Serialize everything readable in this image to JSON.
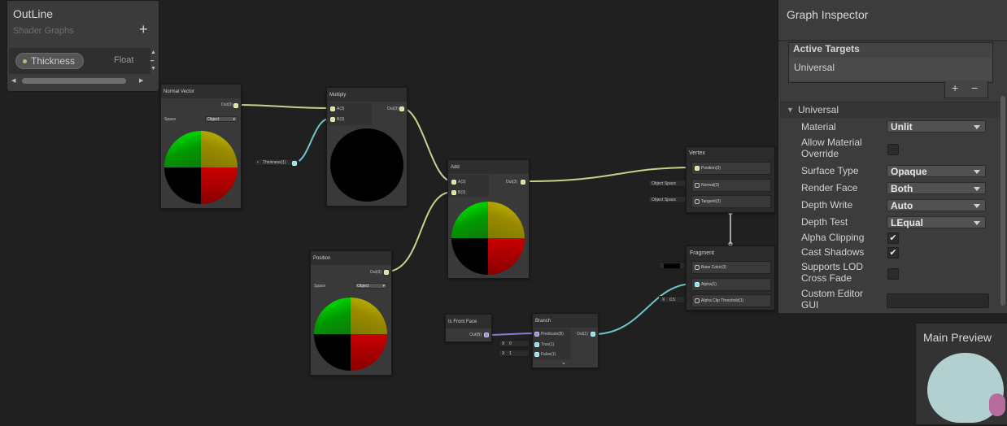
{
  "blackboard": {
    "title": "OutLine",
    "subtitle": "Shader Graphs",
    "add_symbol": "+",
    "property": {
      "name": "Thickness",
      "type": "Float"
    }
  },
  "nodes": {
    "normal_vector": {
      "title": "Normal Vector",
      "out": "Out(3)",
      "space_label": "Space",
      "space_value": "Object"
    },
    "multiply": {
      "title": "Multiply",
      "a": "A(3)",
      "b": "B(3)",
      "out": "Out(3)"
    },
    "thickness_prop": {
      "label": "Thickness(1)"
    },
    "add": {
      "title": "Add",
      "a": "A(3)",
      "b": "B(3)",
      "out": "Out(3)"
    },
    "position": {
      "title": "Position",
      "out": "Out(3)",
      "space_label": "Space",
      "space_value": "Object"
    },
    "vertex": {
      "title": "Vertex",
      "position": "Position(3)",
      "normal": "Normal(3)",
      "tangent": "Tangent(3)",
      "normal_space": "Object Space",
      "tangent_space": "Object Space"
    },
    "fragment": {
      "title": "Fragment",
      "base_color": "Base Color(3)",
      "alpha": "Alpha(1)",
      "alpha_clip": "Alpha Clip Threshold(1)",
      "alpha_clip_x": "X",
      "alpha_clip_value": "0.5"
    },
    "is_front_face": {
      "title": "Is Front Face",
      "out": "Out(B)"
    },
    "branch": {
      "title": "Branch",
      "predicate": "Predicate(B)",
      "true_label": "True(1)",
      "false_label": "False(1)",
      "out": "Out(1)",
      "true_x": "X",
      "true_value": "0",
      "false_x": "X",
      "false_value": "1"
    }
  },
  "inspector": {
    "title": "Graph Inspector",
    "active_targets_label": "Active Targets",
    "targets": [
      "Universal"
    ],
    "plus": "+",
    "minus": "−",
    "section": "Universal",
    "rows": {
      "material": {
        "label": "Material",
        "value": "Unlit"
      },
      "allow_override": {
        "label": "Allow Material Override",
        "checked": false
      },
      "surface_type": {
        "label": "Surface Type",
        "value": "Opaque"
      },
      "render_face": {
        "label": "Render Face",
        "value": "Both"
      },
      "depth_write": {
        "label": "Depth Write",
        "value": "Auto"
      },
      "depth_test": {
        "label": "Depth Test",
        "value": "LEqual"
      },
      "alpha_clipping": {
        "label": "Alpha Clipping",
        "checked": true
      },
      "cast_shadows": {
        "label": "Cast Shadows",
        "checked": true
      },
      "lod_crossfade": {
        "label": "Supports LOD Cross Fade",
        "checked": false
      },
      "custom_editor": {
        "label": "Custom Editor GUI",
        "value": ""
      }
    },
    "check_glyph": "✔"
  },
  "preview": {
    "title": "Main Preview"
  },
  "colors": {
    "vector3_wire": "#c9d08c",
    "float_wire": "#6fc6c8",
    "bool_wire": "#8b7ad2",
    "background": "#202020"
  }
}
